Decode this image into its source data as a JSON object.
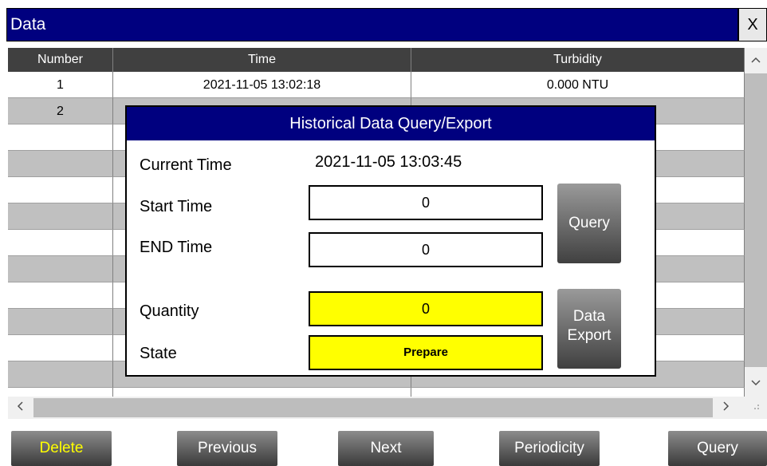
{
  "window": {
    "title": "Data",
    "close_label": "X"
  },
  "table": {
    "columns": [
      "Number",
      "Time",
      "Turbidity"
    ],
    "rows": [
      {
        "number": "1",
        "time": "2021-11-05 13:02:18",
        "turbidity": "0.000 NTU"
      },
      {
        "number": "2",
        "time": "",
        "turbidity": ""
      }
    ]
  },
  "scroll": {
    "up": "^",
    "down": "v",
    "left": "<",
    "right": ">",
    "grip": "..."
  },
  "dialog": {
    "title": "Historical Data Query/Export",
    "current_time_label": "Current Time",
    "current_time_value": "2021-11-05 13:03:45",
    "start_time_label": "Start Time",
    "start_time_value": "0",
    "end_time_label": "END Time",
    "end_time_value": "0",
    "quantity_label": "Quantity",
    "quantity_value": "0",
    "state_label": "State",
    "state_value": "Prepare",
    "query_button": "Query",
    "export_button_line1": "Data",
    "export_button_line2": "Export"
  },
  "toolbar": {
    "delete": "Delete",
    "previous": "Previous",
    "next": "Next",
    "periodicity": "Periodicity",
    "query": "Query"
  },
  "colors": {
    "titlebar": "#00007f",
    "highlight": "#ffff00",
    "header": "#404040"
  }
}
